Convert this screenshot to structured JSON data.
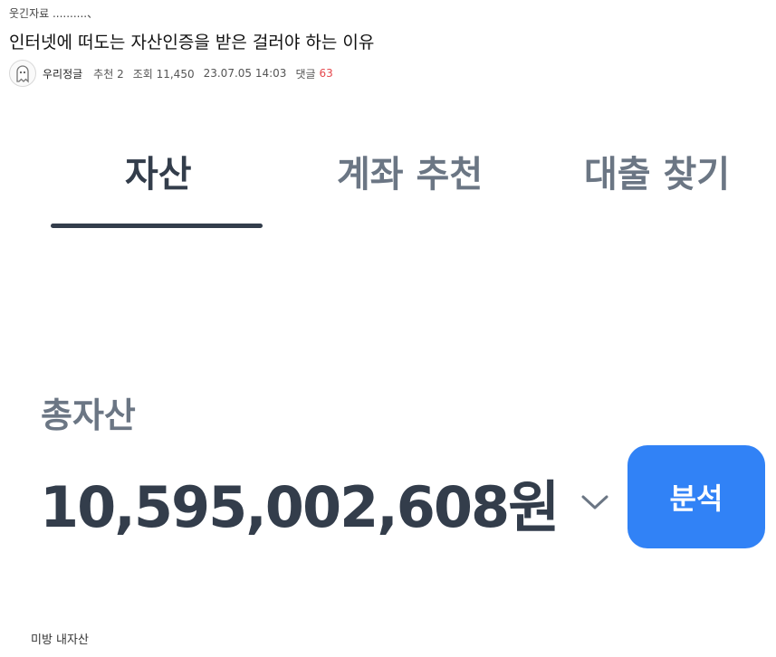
{
  "post": {
    "category": "웃긴자료 ..........、",
    "title": "인터넷에 떠도는 자산인증을 받은 걸러야 하는 이유"
  },
  "meta": {
    "author": "우리정글",
    "recommend": "추천 2",
    "views": "조회 11,450",
    "date": "23.07.05 14:03",
    "comments_label": "댓글",
    "comments_count": "63",
    "comment_color": "#e5484d"
  },
  "app": {
    "tabs": [
      {
        "label": "자산",
        "active": true
      },
      {
        "label": "계좌 추천",
        "active": false
      },
      {
        "label": "대출 찾기",
        "active": false
      }
    ],
    "total_label": "총자산",
    "total_value": "10,595,002,608원",
    "analyze_label": "분석",
    "accent_color": "#3182f6",
    "text_dark": "#333d4b",
    "text_gray": "#6b7684"
  },
  "caption": "미방 내자산",
  "icons": {
    "avatar": "ghost-avatar-icon",
    "dropdown": "chevron-down-icon"
  }
}
